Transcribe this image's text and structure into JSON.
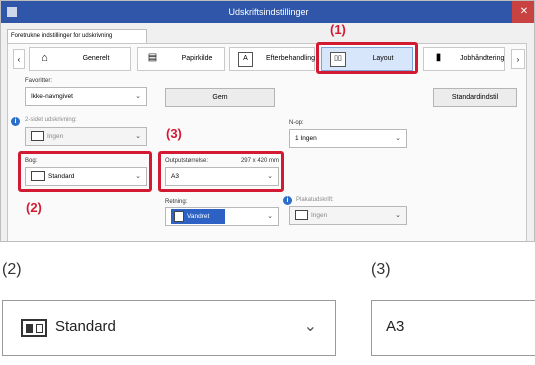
{
  "window": {
    "title": "Udskriftsindstillinger",
    "tab": "Foretrukne indstillinger for udskrivning"
  },
  "nav": {
    "items": [
      {
        "label": "Generelt",
        "icon": "home-icon"
      },
      {
        "label": "Papirkilde",
        "icon": "paper-icon"
      },
      {
        "label": "Efterbehandling",
        "icon": "finishing-icon"
      },
      {
        "label": "Layout",
        "icon": "layout-icon"
      },
      {
        "label": "Jobhåndtering",
        "icon": "job-icon"
      }
    ],
    "back_icon": "chevron-left-icon",
    "forward_icon": "chevron-right-icon"
  },
  "favorites": {
    "label": "Favoritter:",
    "value": "Ikke-navngivet",
    "save_button": "Gem",
    "default_button": "Standardindstil"
  },
  "duplex": {
    "label": "2-sidet udskrivning:",
    "value": "Ingen"
  },
  "n_up": {
    "label": "N-op:",
    "value": "1 Ingen"
  },
  "fold": {
    "label": "Bog:",
    "value": "Standard"
  },
  "output_size": {
    "label": "Outputstørrelse:",
    "dimensions": "297 x 420 mm",
    "value": "A3"
  },
  "orientation": {
    "label": "Retning:",
    "value": "Vandret"
  },
  "poster": {
    "label": "Plakatudskrift:",
    "value": "Ingen"
  },
  "callouts": {
    "c1": "(1)",
    "c2": "(2)",
    "c3": "(3)"
  },
  "zoom": {
    "left_label": "(2)",
    "right_label": "(3)",
    "left_value": "Standard",
    "right_value": "A3"
  },
  "colors": {
    "titlebar": "#2f56a8",
    "highlight": "#d31a33"
  }
}
